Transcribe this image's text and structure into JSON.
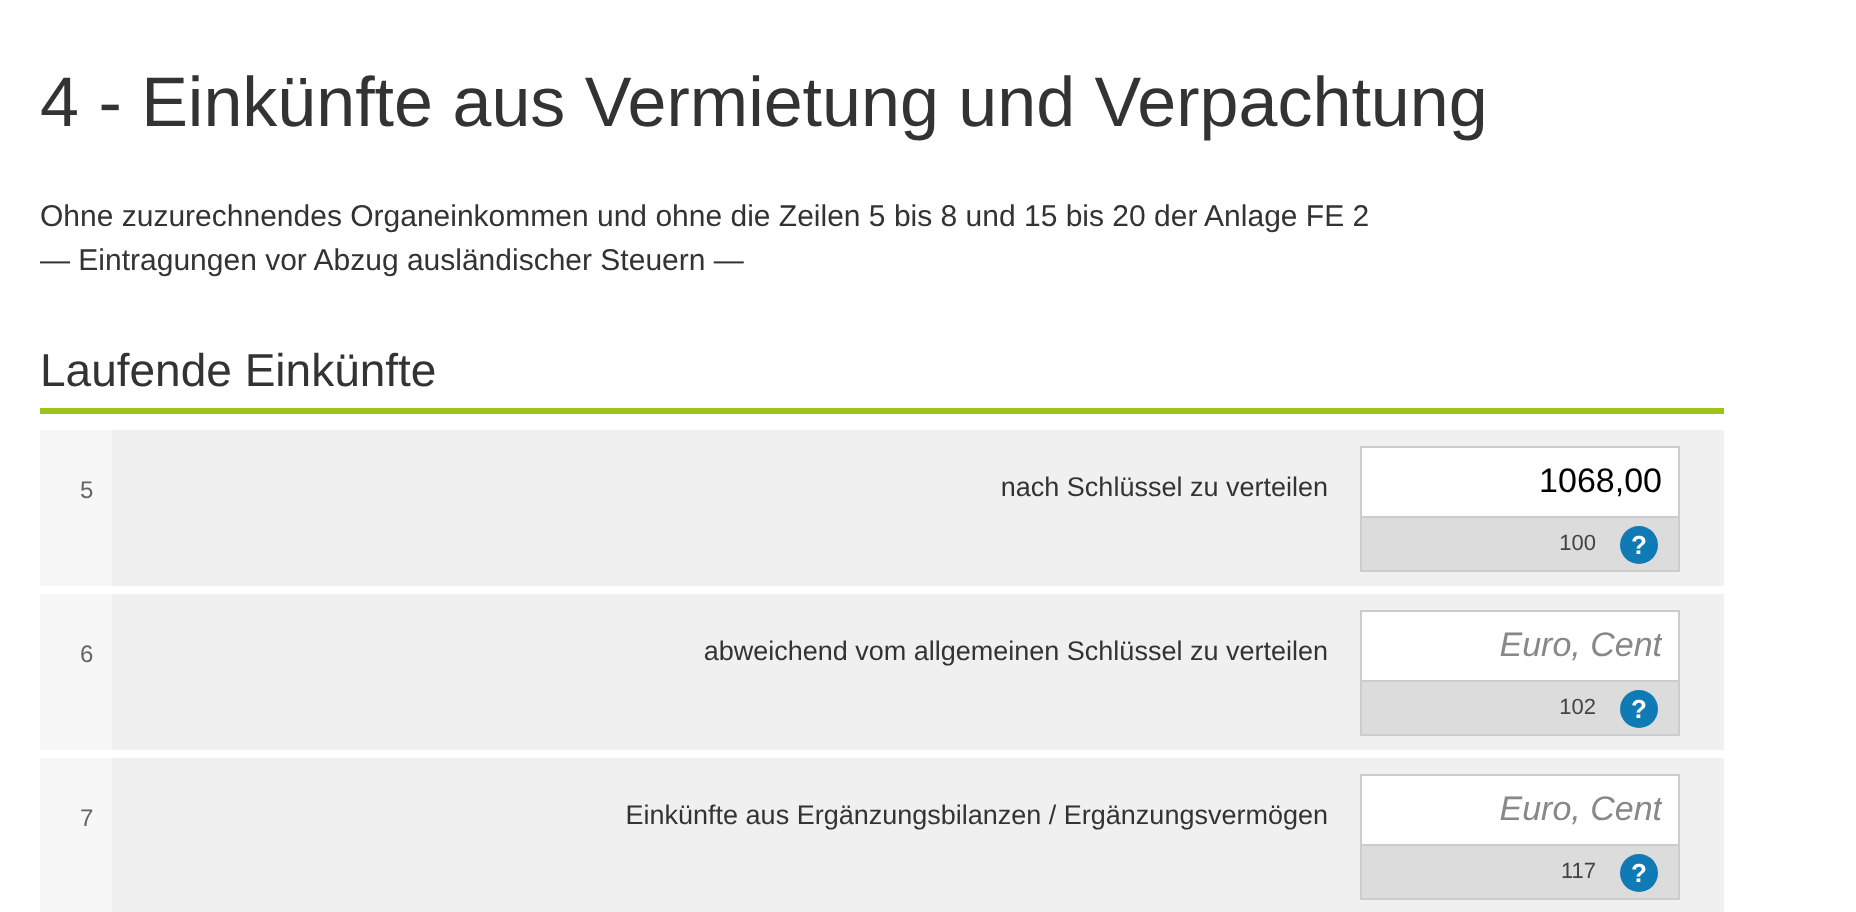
{
  "title": "4 - Einkünfte aus Vermietung und Verpachtung",
  "intro": [
    "Ohne zuzurechnendes Organeinkommen und ohne die Zeilen 5 bis 8 und 15 bis 20 der Anlage FE 2",
    "— Eintragungen vor Abzug ausländischer Steuern —"
  ],
  "section": {
    "title": "Laufende Einkünfte"
  },
  "rows": [
    {
      "line": "5",
      "label": "nach Schlüssel zu verteilen",
      "value": "1068,00",
      "code": "100",
      "help": "?"
    },
    {
      "line": "6",
      "label": "abweichend vom allgemeinen Schlüssel zu verteilen",
      "placeholder": "Euro, Cent",
      "code": "102",
      "help": "?"
    },
    {
      "line": "7",
      "label": "Einkünfte aus Ergänzungsbilanzen / Ergänzungsvermögen",
      "placeholder": "Euro, Cent",
      "code": "117",
      "help": "?"
    }
  ]
}
